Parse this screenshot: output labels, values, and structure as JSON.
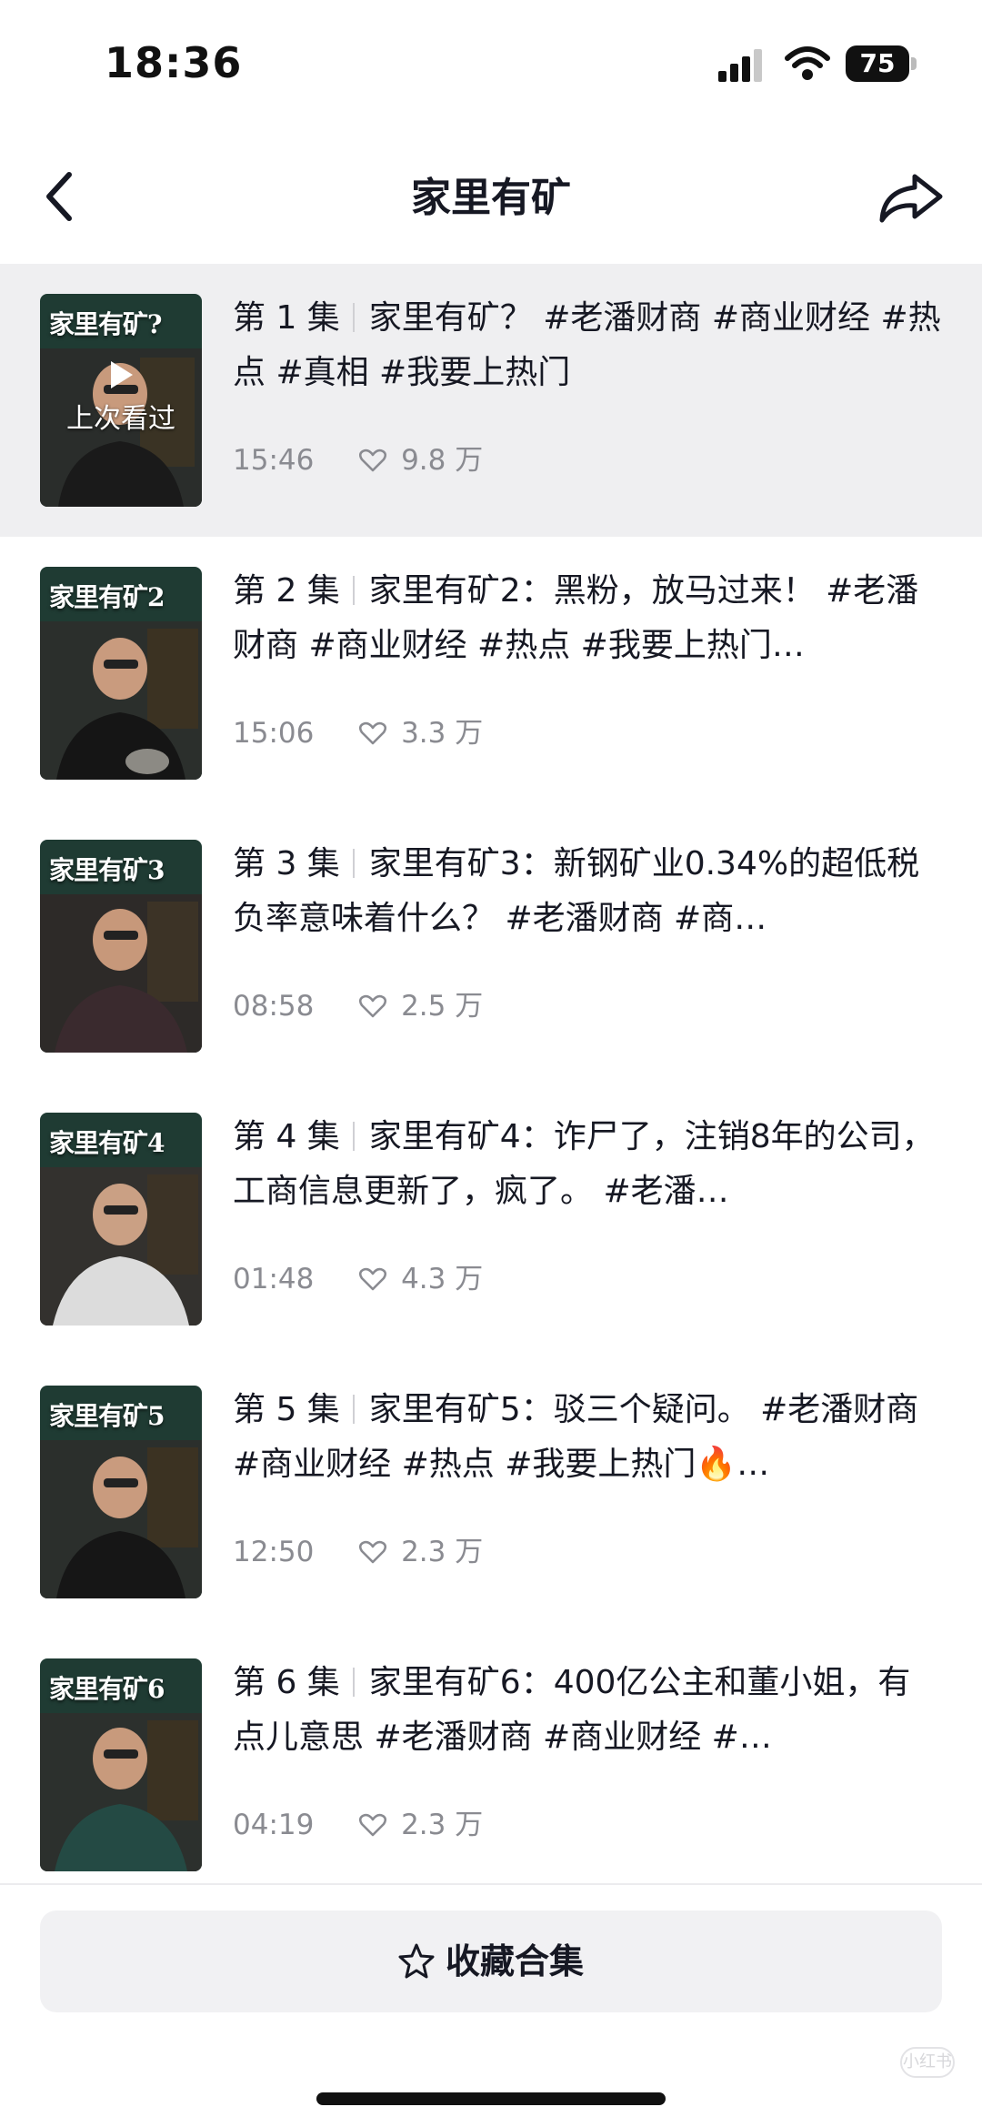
{
  "status_bar": {
    "time": "18:36",
    "battery": "75"
  },
  "nav": {
    "title": "家里有矿"
  },
  "episodes": [
    {
      "ep_label": "第 1 集",
      "text": "家里有矿？ #老潘财商 #商业财经 #热点 #真相 #我要上热门",
      "duration": "15:46",
      "likes": "9.8 万",
      "thumb_title": "家里有矿?",
      "resume_label": "上次看过",
      "is_current": true
    },
    {
      "ep_label": "第 2 集",
      "text": "家里有矿2：黑粉，放马过来！ #老潘财商 #商业财经 #热点 #我要上热门…",
      "duration": "15:06",
      "likes": "3.3 万",
      "thumb_title": "家里有矿2"
    },
    {
      "ep_label": "第 3 集",
      "text": "家里有矿3：新钢矿业0.34%的超低税负率意味着什么？ #老潘财商 #商…",
      "duration": "08:58",
      "likes": "2.5 万",
      "thumb_title": "家里有矿3"
    },
    {
      "ep_label": "第 4 集",
      "text": "家里有矿4：诈尸了，注销8年的公司，工商信息更新了，疯了。 #老潘…",
      "duration": "01:48",
      "likes": "4.3 万",
      "thumb_title": "家里有矿4"
    },
    {
      "ep_label": "第 5 集",
      "text": "家里有矿5：驳三个疑问。 #老潘财商 #商业财经 #热点 #我要上热门🔥…",
      "duration": "12:50",
      "likes": "2.3 万",
      "thumb_title": "家里有矿5"
    },
    {
      "ep_label": "第 6 集",
      "text": "家里有矿6：400亿公主和董小姐，有点儿意思 #老潘财商 #商业财经 #…",
      "duration": "04:19",
      "likes": "2.3 万",
      "thumb_title": "家里有矿6"
    }
  ],
  "footer": {
    "collect_label": "收藏合集",
    "watermark": "小红书"
  },
  "colors": {
    "current_row_bg": "#efeff1",
    "meta_text": "#8a8b91",
    "thumb_bg": "#1f3b33"
  },
  "icons": [
    "back-icon",
    "share-icon",
    "play-icon",
    "heart-icon",
    "star-icon",
    "cellular-icon",
    "wifi-icon",
    "battery-icon"
  ]
}
